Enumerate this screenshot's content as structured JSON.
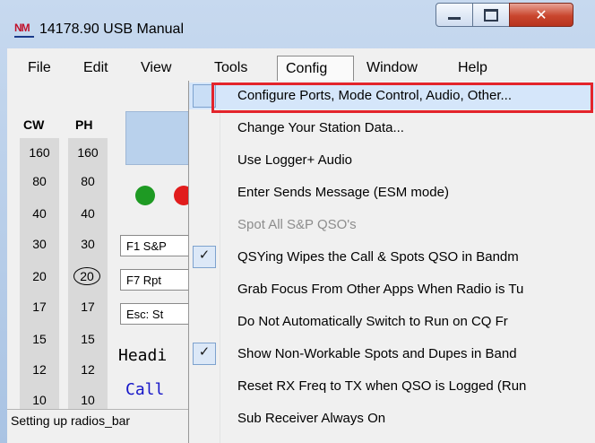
{
  "window": {
    "title": "14178.90 USB Manual",
    "app_icon_text": "NM",
    "caption_buttons": {
      "minimize": "minimize",
      "maximize": "maximize",
      "close": "✕"
    }
  },
  "menubar": {
    "items": [
      {
        "label": "File",
        "accel": "F"
      },
      {
        "label": "Edit",
        "accel": "E"
      },
      {
        "label": "View",
        "accel": "V"
      },
      {
        "label": "Tools",
        "accel": ""
      },
      {
        "label": "Config",
        "accel": "C"
      },
      {
        "label": "Window",
        "accel": "n"
      },
      {
        "label": "Help",
        "accel": ""
      }
    ]
  },
  "bands": {
    "cw_header": "CW",
    "ph_header": "PH",
    "cw": [
      "160",
      "80",
      "40",
      "30",
      "20",
      "17",
      "15",
      "12",
      "10"
    ],
    "ph": [
      "160",
      "80",
      "40",
      "30",
      "20",
      "17",
      "15",
      "12",
      "10"
    ],
    "selected_ph": "20"
  },
  "indicators": {
    "led_green": "#1e9a23",
    "led_red": "#e11c1c"
  },
  "function_keys": [
    "F1 S&P",
    "F7 Rpt",
    "Esc: St"
  ],
  "entry_labels": {
    "heading": "Headi",
    "call": "Call"
  },
  "status_bar": "Setting up radios_bar",
  "config_menu": {
    "items": [
      {
        "label": "Configure Ports, Mode Control, Audio, Other...",
        "checked": false,
        "disabled": false,
        "highlight": true
      },
      {
        "label": "Change Your Station Data...",
        "checked": false,
        "disabled": false
      },
      {
        "label": "Use Logger+ Audio",
        "checked": false,
        "disabled": false
      },
      {
        "label": "Enter Sends Message (ESM mode)",
        "checked": false,
        "disabled": false
      },
      {
        "label": "Spot All S&P QSO's",
        "checked": false,
        "disabled": true
      },
      {
        "label": "QSYing Wipes the Call & Spots QSO in Bandm",
        "checked": true,
        "disabled": false
      },
      {
        "label": "Grab Focus From Other Apps When Radio is Tu",
        "checked": false,
        "disabled": false
      },
      {
        "label": "Do Not Automatically Switch to Run on CQ Fr",
        "checked": false,
        "disabled": false
      },
      {
        "label": "Show Non-Workable Spots and Dupes in Band",
        "checked": true,
        "disabled": false
      },
      {
        "label": "Reset RX Freq to TX when QSO is Logged (Run",
        "checked": false,
        "disabled": false
      },
      {
        "label": "Sub Receiver Always On",
        "checked": false,
        "disabled": false
      }
    ],
    "check_glyph": "✓",
    "highlight_color": "#d5e6fa",
    "annotation_color": "#e3242b"
  }
}
